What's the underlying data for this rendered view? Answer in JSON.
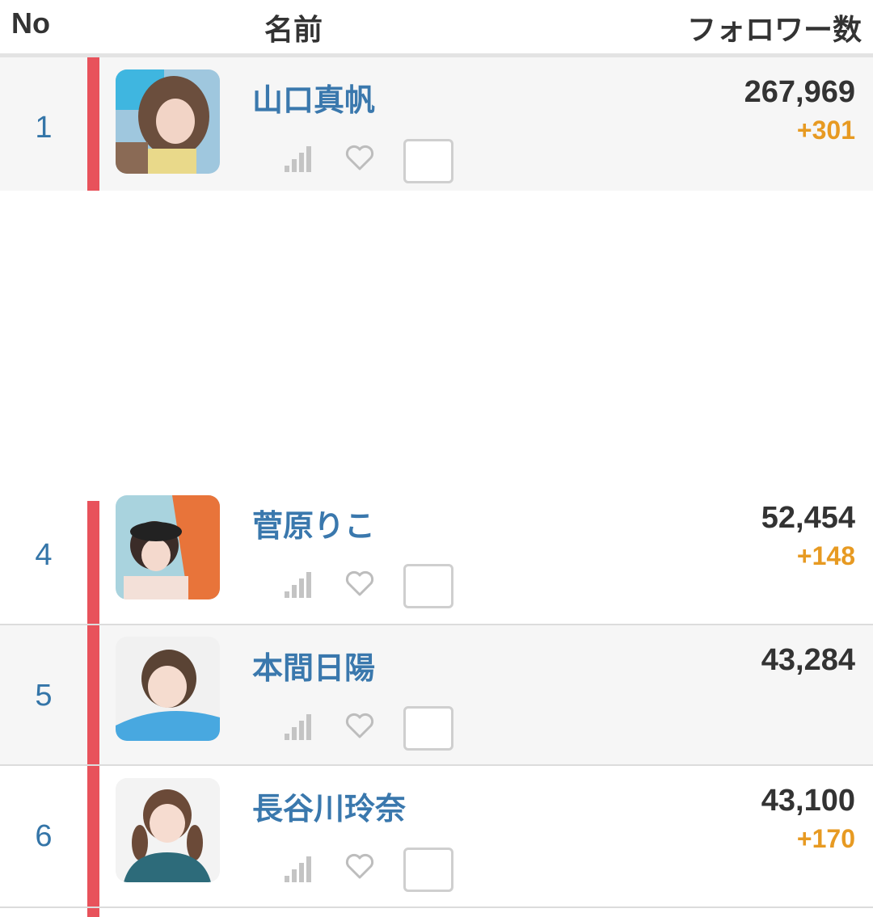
{
  "header": {
    "no": "No",
    "name": "名前",
    "followers": "フォロワー数"
  },
  "accent_color": "#e8525b",
  "rows": [
    {
      "rank": "1",
      "name": "山口真帆",
      "followers": "267,969",
      "diff": "+301",
      "icons": [
        "signal-bars-icon",
        "heart-icon"
      ]
    },
    {
      "rank": "4",
      "name": "菅原りこ",
      "followers": "52,454",
      "diff": "+148",
      "icons": [
        "signal-bars-icon",
        "heart-icon"
      ]
    },
    {
      "rank": "5",
      "name": "本間日陽",
      "followers": "43,284",
      "diff": "",
      "icons": [
        "signal-bars-icon",
        "heart-icon"
      ]
    },
    {
      "rank": "6",
      "name": "長谷川玲奈",
      "followers": "43,100",
      "diff": "+170",
      "icons": [
        "signal-bars-icon",
        "heart-icon"
      ]
    }
  ]
}
